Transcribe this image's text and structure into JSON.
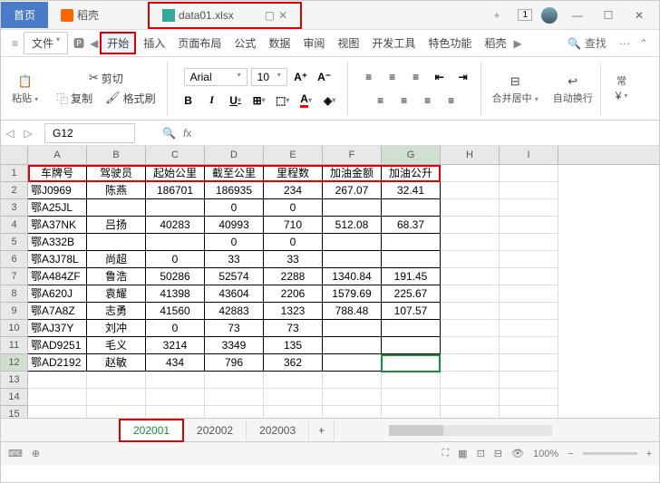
{
  "titlebar": {
    "home": "首页",
    "doc_tab": "稻壳",
    "file_tab": "data01.xlsx",
    "badge": "1"
  },
  "menu": {
    "file": "文件",
    "items": [
      "开始",
      "插入",
      "页面布局",
      "公式",
      "数据",
      "审阅",
      "视图",
      "开发工具",
      "特色功能",
      "稻壳"
    ],
    "search": "查找"
  },
  "toolbar": {
    "cut": "剪切",
    "copy": "复制",
    "paste": "粘贴",
    "fmtpaint": "格式刷",
    "font": "Arial",
    "size": "10",
    "merge": "合并居中",
    "wrap": "自动换行",
    "currency": "常"
  },
  "namebox": "G12",
  "columns": [
    "A",
    "B",
    "C",
    "D",
    "E",
    "F",
    "G",
    "H",
    "I"
  ],
  "headers": [
    "车牌号",
    "驾驶员",
    "起始公里",
    "截至公里",
    "里程数",
    "加油金额",
    "加油公升"
  ],
  "chart_data": {
    "type": "table",
    "rows": [
      {
        "车牌号": "鄂J0969",
        "驾驶员": "陈燕",
        "起始公里": 186701,
        "截至公里": 186935,
        "里程数": 234,
        "加油金额": 267.07,
        "加油公升": 32.41
      },
      {
        "车牌号": "鄂A25JL",
        "驾驶员": "",
        "起始公里": null,
        "截至公里": 0,
        "里程数": 0,
        "加油金额": null,
        "加油公升": null
      },
      {
        "车牌号": "鄂A37NK",
        "驾驶员": "吕扬",
        "起始公里": 40283,
        "截至公里": 40993,
        "里程数": 710,
        "加油金额": 512.08,
        "加油公升": 68.37
      },
      {
        "车牌号": "鄂A332B",
        "驾驶员": "",
        "起始公里": null,
        "截至公里": 0,
        "里程数": 0,
        "加油金额": null,
        "加油公升": null
      },
      {
        "车牌号": "鄂A3J78L",
        "驾驶员": "尚超",
        "起始公里": 0,
        "截至公里": 33,
        "里程数": 33,
        "加油金额": null,
        "加油公升": null
      },
      {
        "车牌号": "鄂A484ZF",
        "驾驶员": "鲁浩",
        "起始公里": 50286,
        "截至公里": 52574,
        "里程数": 2288,
        "加油金额": 1340.84,
        "加油公升": 191.45
      },
      {
        "车牌号": "鄂A620J",
        "驾驶员": "袁耀",
        "起始公里": 41398,
        "截至公里": 43604,
        "里程数": 2206,
        "加油金额": 1579.69,
        "加油公升": 225.67
      },
      {
        "车牌号": "鄂A7A8Z",
        "驾驶员": "志勇",
        "起始公里": 41560,
        "截至公里": 42883,
        "里程数": 1323,
        "加油金额": 788.48,
        "加油公升": 107.57
      },
      {
        "车牌号": "鄂AJ37Y",
        "驾驶员": "刘冲",
        "起始公里": 0,
        "截至公里": 73,
        "里程数": 73,
        "加油金额": null,
        "加油公升": null
      },
      {
        "车牌号": "鄂AD9251",
        "驾驶员": "毛义",
        "起始公里": 3214,
        "截至公里": 3349,
        "里程数": 135,
        "加油金额": null,
        "加油公升": null
      },
      {
        "车牌号": "鄂AD2192",
        "驾驶员": "赵敏",
        "起始公里": 434,
        "截至公里": 796,
        "里程数": 362,
        "加油金额": null,
        "加油公升": null
      }
    ]
  },
  "sheets": [
    "202001",
    "202002",
    "202003"
  ],
  "status": {
    "zoom": "100%"
  }
}
